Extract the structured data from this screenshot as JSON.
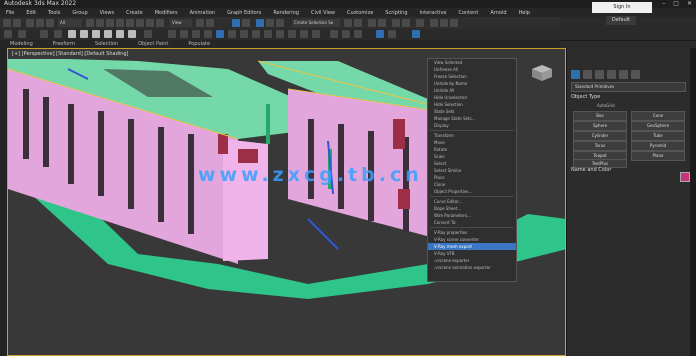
{
  "window": {
    "title": "Autodesk 3ds Max 2022",
    "sign_in": "Sign In",
    "workspace": "Default",
    "controls": [
      "–",
      "□",
      "✕"
    ]
  },
  "menubar": [
    "File",
    "Edit",
    "Tools",
    "Group",
    "Views",
    "Create",
    "Modifiers",
    "Animation",
    "Graph Editors",
    "Rendering",
    "Civil View",
    "Customize",
    "Scripting",
    "Interactive",
    "Content",
    "Arnold",
    "Help"
  ],
  "toolbar1": {
    "selection_filter": "All",
    "view_dropdown": "View",
    "selection_set": "Create Selection Se"
  },
  "ribbon": {
    "tabs": [
      "Modeling",
      "Freeform",
      "Selection",
      "Object Paint",
      "Populate"
    ]
  },
  "viewport": {
    "label": "[+] [Perspective] [Standard] [Default Shading]",
    "watermark": "www.zxcg.tb.cn"
  },
  "quad_menu": {
    "items": [
      "View Selected",
      "Unfreeze All",
      "Freeze Selection",
      "Unhide by Name",
      "Unhide All",
      "Hide Unselected",
      "Hide Selection",
      "State Sets",
      "Manage State Sets...",
      "Display",
      "Transform",
      "Move",
      "Rotate",
      "Scale",
      "Select",
      "Select Similar",
      "Place",
      "Clone",
      "Object Properties...",
      "Curve Editor...",
      "Dope Sheet...",
      "Wire Parameters...",
      "Convert To:",
      "V-Ray properties",
      "V-Ray scene converter",
      "V-Ray mesh export",
      "V-Ray VFB",
      ".vrscene exporter",
      ".vrscene animation exporter"
    ],
    "highlighted_index": 25
  },
  "command_panel": {
    "dropdown": "Standard Primitives",
    "rollout_object_type": "Object Type",
    "autogrid": "AutoGrid",
    "buttons": [
      "Box",
      "Cone",
      "Sphere",
      "GeoSphere",
      "Cylinder",
      "Tube",
      "Torus",
      "Pyramid",
      "Teapot",
      "Plane",
      "TextPlus"
    ],
    "rollout_name_color": "Name and Color",
    "swatch_color": "#c4357c"
  },
  "colors": {
    "accent": "#2f6fb0",
    "viewport_border": "#c7a227",
    "ground": "#2ec48a",
    "walls": "#e3a6dc"
  }
}
